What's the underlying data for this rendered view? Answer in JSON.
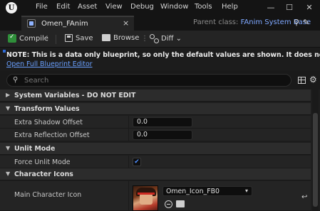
{
  "menu": {
    "logo": "U",
    "items": [
      "File",
      "Edit",
      "Asset",
      "View",
      "Debug",
      "Window",
      "Tools",
      "Help"
    ]
  },
  "window_controls": {
    "minimize": "—",
    "maximize": "☐",
    "close": "✕"
  },
  "tab": {
    "title": "Omen_FAnim",
    "close": "×"
  },
  "parent_class": {
    "label": "Parent class:",
    "value": "FAnim System Base"
  },
  "toolbar": {
    "compile_label": "Compile",
    "save_label": "Save",
    "browse_label": "Browse",
    "diff_label": "Diff",
    "diff_chevron": "⌄",
    "more": "⋮"
  },
  "notice": {
    "text": "NOTE: This is a data only blueprint, so only the default values are shown.  It does not have any script or variable",
    "link": "Open Full Blueprint Editor"
  },
  "search": {
    "placeholder": "Search",
    "value": ""
  },
  "details": {
    "categories": [
      {
        "label": "System Variables - DO NOT EDIT",
        "expanded": false
      },
      {
        "label": "Transform Values",
        "expanded": true
      },
      {
        "label": "Unlit Mode",
        "expanded": true
      },
      {
        "label": "Character Icons",
        "expanded": true
      }
    ],
    "properties": {
      "extra_shadow_offset": {
        "label": "Extra Shadow Offset",
        "value": "0.0"
      },
      "extra_reflection_offset": {
        "label": "Extra Reflection Offset",
        "value": "0.0"
      },
      "force_unlit_mode": {
        "label": "Force Unlit Mode",
        "checked": true,
        "check_glyph": "✔"
      },
      "main_character_icon": {
        "label": "Main Character Icon",
        "asset": "Omen_Icon_FB0",
        "reset_glyph": "↩"
      }
    }
  },
  "icons": {
    "search": "⚲",
    "settings": "⚙",
    "edit": "✎",
    "expanded": "▼",
    "collapsed": "▶",
    "chevron": "▾"
  },
  "colors": {
    "accent_blue": "#6aa0ff",
    "compile_green": "#2f8f3a",
    "panel_bg": "#1e1e1e"
  }
}
